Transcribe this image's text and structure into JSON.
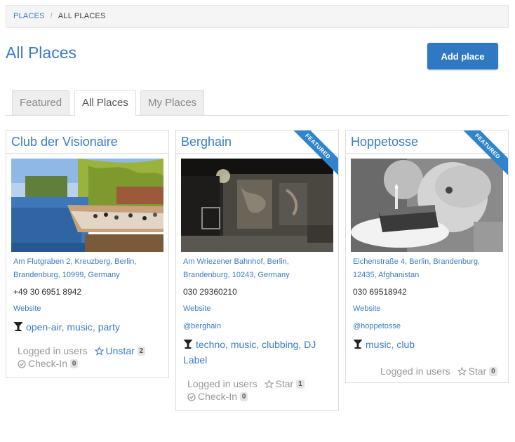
{
  "breadcrumb": {
    "root": "PLACES",
    "current": "ALL PLACES"
  },
  "page": {
    "title": "All Places",
    "add_button": "Add place"
  },
  "tabs": [
    {
      "label": "Featured",
      "active": false
    },
    {
      "label": "All Places",
      "active": true
    },
    {
      "label": "My Places",
      "active": false
    }
  ],
  "places": [
    {
      "name": "Club der Visionaire",
      "featured": false,
      "photo_icon": "canal-terrace-photo",
      "address": "Am Flutgraben 2, Kreuzberg, Berlin, Brandenburg, 10999, Germany",
      "phone": "+49 30 6951 8942",
      "website": "Website",
      "handle": "",
      "tags": [
        "open-air",
        "music",
        "party"
      ],
      "logged_in": "Logged in users",
      "star_label": "Unstar",
      "star_count": "2",
      "checkin_label": "Check-In",
      "checkin_count": "0"
    },
    {
      "name": "Berghain",
      "featured": true,
      "ribbon": "FEATURED",
      "photo_icon": "graffiti-wall-photo",
      "address": "Am Wriezener Bahnhof, Berlin, Brandenburg, 10243, Germany",
      "phone": "030 29360210",
      "website": "Website",
      "handle": "@berghain",
      "tags": [
        "techno",
        "music",
        "clubbing",
        "DJ Label"
      ],
      "logged_in": "Logged in users",
      "star_label": "Star",
      "star_count": "1",
      "checkin_label": "Check-In",
      "checkin_count": "0"
    },
    {
      "name": "Hoppetosse",
      "featured": true,
      "ribbon": "FEATURED",
      "photo_icon": "birthday-cake-photo",
      "address": "Eichenstraße 4, Berlin, Brandenburg, 12435, Afghanistan",
      "phone": "030 69518942",
      "website": "Website",
      "handle": "@hoppetosse",
      "tags": [
        "music",
        "club"
      ],
      "logged_in": "Logged in users",
      "star_label": "Star",
      "star_count": "0"
    }
  ],
  "colors": {
    "accent": "#3a7cc5",
    "button": "#2f78c4",
    "ribbon": "#2f84cc"
  }
}
